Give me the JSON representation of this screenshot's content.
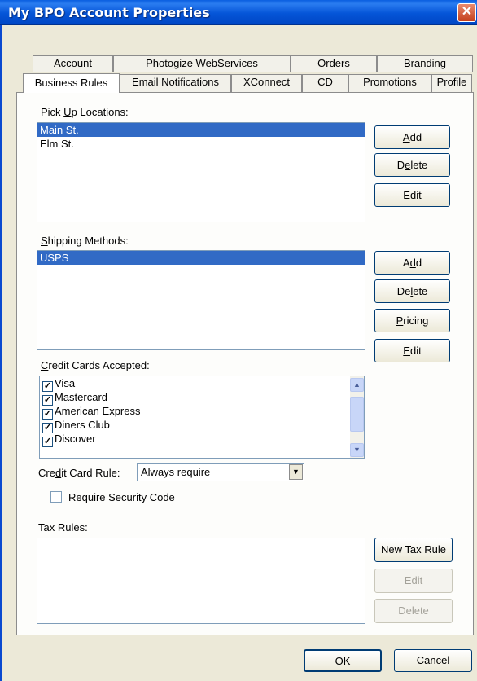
{
  "window": {
    "title": "My BPO Account Properties",
    "close_glyph": "✕"
  },
  "tabs_row1": [
    "Account",
    "Photogize WebServices",
    "Orders",
    "Branding"
  ],
  "tabs_row2": [
    "Business Rules",
    "Email Notifications",
    "XConnect",
    "CD",
    "Promotions",
    "Profile"
  ],
  "pickup": {
    "label_pre": "Pick ",
    "label_ul": "U",
    "label_post": "p Locations:",
    "items": [
      "Main St.",
      "Elm St."
    ],
    "buttons": {
      "add": "Add",
      "delete": "Delete",
      "edit": "Edit"
    }
  },
  "shipping": {
    "label_ul": "S",
    "label_post": "hipping Methods:",
    "items": [
      "USPS"
    ],
    "buttons": {
      "add": "Add",
      "delete": "Delete",
      "pricing": "Pricing",
      "edit": "Edit"
    }
  },
  "credit_cards": {
    "label_ul": "C",
    "label_post": "redit Cards Accepted:",
    "items": [
      "Visa",
      "Mastercard",
      "American Express",
      "Diners Club",
      "Discover"
    ],
    "check_glyph": "✓"
  },
  "cc_rule": {
    "label_pre": "Cre",
    "label_ul": "d",
    "label_post": "it Card Rule:",
    "value": "Always require",
    "arrow_glyph": "▼"
  },
  "security_code": {
    "label": "Require Security Code",
    "checked": false
  },
  "tax": {
    "label": "Tax Rules:",
    "new_button": "New Tax Rule",
    "edit_button": "Edit",
    "delete_button": "Delete"
  },
  "footer": {
    "ok": "OK",
    "cancel": "Cancel"
  },
  "scroll_glyphs": {
    "up": "▲",
    "down": "▼"
  }
}
